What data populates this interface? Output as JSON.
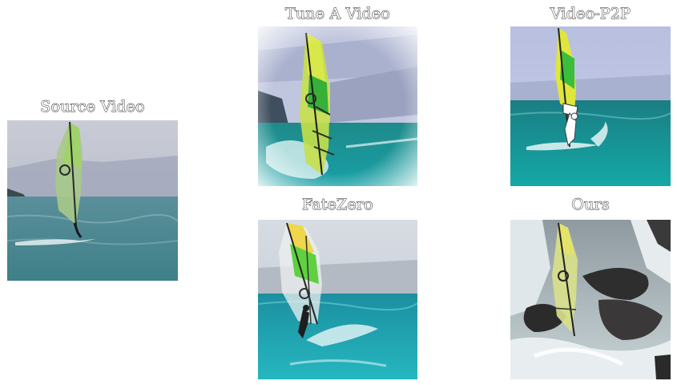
{
  "panels": {
    "source": {
      "caption": "Source Video",
      "image": "windsurfer on calm sea"
    },
    "tune_a_video": {
      "caption": "Tune A Video",
      "image": "windsurfer with distorted background"
    },
    "video_p2p": {
      "caption": "Video-P2P",
      "image": "white figure windsurfing on turquoise water"
    },
    "fatezero": {
      "caption": "FateZero",
      "image": "windsurfer jumping on turquoise water"
    },
    "ours": {
      "caption": "Ours",
      "image": "windsurfer among dark rocks and white water"
    }
  }
}
